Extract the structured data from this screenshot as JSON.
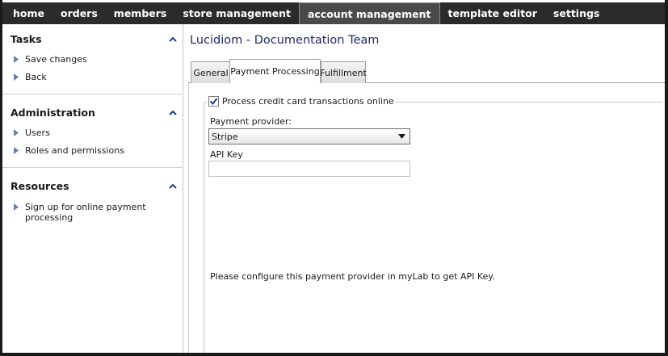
{
  "nav": {
    "items": [
      {
        "label": "home"
      },
      {
        "label": "orders"
      },
      {
        "label": "members"
      },
      {
        "label": "store management"
      },
      {
        "label": "account management"
      },
      {
        "label": "template editor"
      },
      {
        "label": "settings"
      }
    ],
    "active_index": 4
  },
  "sidebar": {
    "tasks": {
      "title": "Tasks",
      "items": [
        {
          "label": "Save changes"
        },
        {
          "label": "Back"
        }
      ]
    },
    "administration": {
      "title": "Administration",
      "items": [
        {
          "label": "Users"
        },
        {
          "label": "Roles and permissions"
        }
      ]
    },
    "resources": {
      "title": "Resources",
      "items": [
        {
          "label": "Sign up for online payment processing"
        }
      ]
    }
  },
  "main": {
    "title": "Lucidiom - Documentation Team",
    "tabs": [
      {
        "label": "General"
      },
      {
        "label": "Payment Processing"
      },
      {
        "label": "Fulfillment"
      }
    ],
    "active_tab": 1,
    "payment": {
      "process_online_label": "Process credit card transactions online",
      "process_online_checked": true,
      "provider_label": "Payment provider:",
      "provider_value": "Stripe",
      "api_key_label": "API Key",
      "api_key_value": "",
      "info_text": "Please configure this payment provider in myLab to get API Key."
    }
  },
  "colors": {
    "nav_bg": "#2b2b2b",
    "nav_active_bg": "#4a4a4a",
    "title_color": "#1f2a6e",
    "icon_blue": "#1f3f8a"
  },
  "icons": {
    "collapse": "chevron-up-icon",
    "link_arrow": "triangle-right-icon",
    "select": "triangle-down-icon",
    "check": "checkmark-icon"
  }
}
